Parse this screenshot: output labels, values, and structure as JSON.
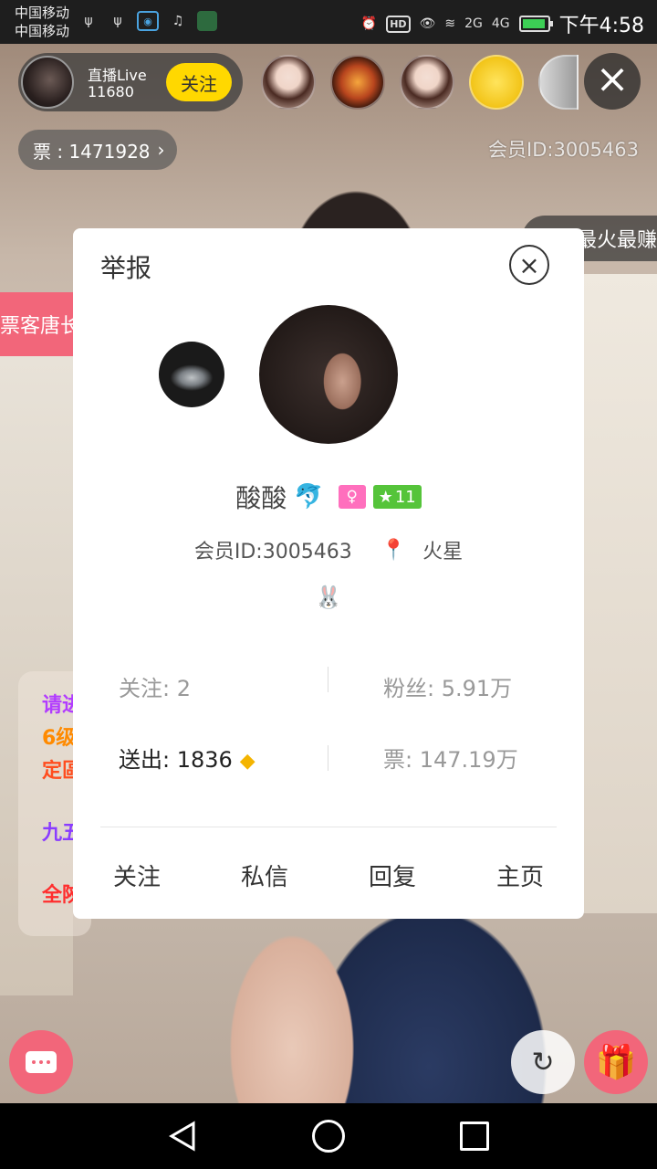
{
  "status_bar": {
    "carrier_1": "中国移动",
    "carrier_2": "中国移动",
    "net_2g": "2G",
    "net_4g": "4G",
    "hd": "HD",
    "time": "下午4:58"
  },
  "header": {
    "host_label": "直播Live",
    "viewer_count": "11680",
    "follow_label": "关注",
    "tickets": "票 : 1471928",
    "member_id": "会员ID:3005463",
    "rank_banner": "最火最赚",
    "pink_tag": "票客唐长"
  },
  "dialog": {
    "report_label": "举报",
    "nickname": "酸酸",
    "level": "11",
    "member_id": "会员ID:3005463",
    "location": "火星",
    "stats": {
      "following_label": "关注: 2",
      "fans_label": "粉丝: 5.91万",
      "sent_label": "送出: 1836",
      "tickets_label": "票: 147.19万"
    },
    "actions": {
      "follow": "关注",
      "message": "私信",
      "reply": "回复",
      "homepage": "主页"
    }
  },
  "chat": {
    "line_1": "请进",
    "line_2": "6级",
    "line_3": "定區",
    "line_4": "九五",
    "line_5": "全陝"
  },
  "colors": {
    "accent_pink": "#f2667a",
    "follow_yellow": "#ffd800",
    "level_green": "#55c43a",
    "gender_pink": "#ff6fbd"
  },
  "icons": [
    "close-icon",
    "chevron-right-icon",
    "dolphin-icon",
    "location-pin-icon",
    "rabbit-icon",
    "gold-bar-icon",
    "chat-icon",
    "share-icon",
    "gift-icon"
  ]
}
